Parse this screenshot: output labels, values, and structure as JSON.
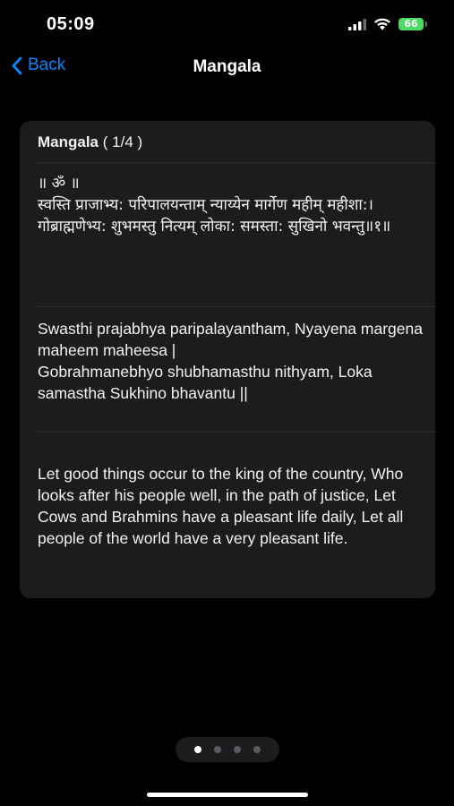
{
  "status_bar": {
    "time": "05:09",
    "battery": "66",
    "icons": [
      "signal-icon",
      "wifi-icon",
      "battery-icon"
    ]
  },
  "nav": {
    "back_label": "Back",
    "title": "Mangala"
  },
  "card": {
    "title": "Mangala",
    "page_indicator": "( 1/4 )",
    "sanskrit": "॥ ॐ ॥\n स्वस्ति प्राजाभ्य: परिपालयन्ताम् न्याय्येन मार्गेण महीम् महीशा:।\n गोब्राह्मणेभ्य: शुभमस्तु नित्यम् लोका: समस्ता: सुखिनो भवन्तु॥१॥",
    "transliteration": "Swasthi prajabhya paripalayantham, Nyayena margena maheem maheesa |\n Gobrahmanebhyo shubhamasthu nithyam, Loka samastha Sukhino bhavantu ||",
    "translation": "Let good things occur to the king of the country, Who looks after his people well, in the path of justice, Let Cows and Brahmins have a pleasant life daily, Let all people of the world have a very pleasant life."
  },
  "pager": {
    "total": 4,
    "current": 1
  },
  "colors": {
    "background": "#000000",
    "card": "#1c1c1e",
    "accent": "#0a84ff",
    "battery": "#4cd964"
  }
}
